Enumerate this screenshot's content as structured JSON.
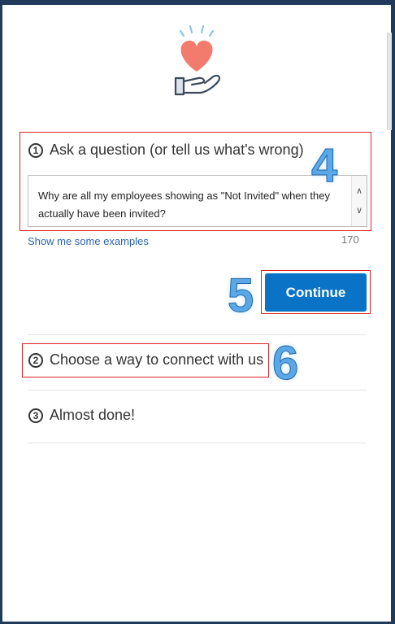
{
  "steps": [
    {
      "number": "1",
      "title": "Ask a question (or tell us what's wrong)"
    },
    {
      "number": "2",
      "title": "Choose a way to connect with us"
    },
    {
      "number": "3",
      "title": "Almost done!"
    }
  ],
  "question": {
    "text": "Why are all my employees showing as \"Not Invited\" when they actually have been invited?",
    "examples_link": "Show me some examples",
    "char_count": "170"
  },
  "continue_label": "Continue",
  "callouts": {
    "four": "4",
    "five": "5",
    "six": "6"
  },
  "colors": {
    "accent": "#0a73c6",
    "highlight": "#dd2222",
    "heart": "#f27b6d",
    "link": "#2a64b4"
  }
}
